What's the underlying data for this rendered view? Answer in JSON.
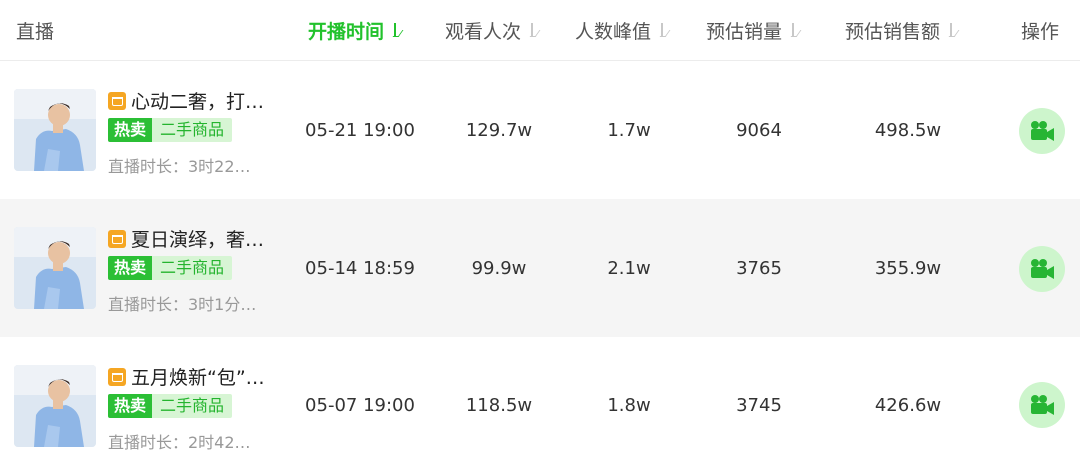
{
  "header": {
    "live": "直播",
    "start_time": "开播时间",
    "views": "观看人次",
    "peak": "人数峰值",
    "est_sales": "预估销量",
    "est_gmv": "预估销售额",
    "actions": "操作"
  },
  "colors": {
    "accent": "#22c22c",
    "tag_hot_bg": "#2bbf35",
    "tag_used_bg": "#d7f5d4",
    "cart_icon": "#f5a623",
    "action_bg": "#cdf5cc",
    "striped_row": "#f5f5f5"
  },
  "rows": [
    {
      "title": "心动二奢，打…",
      "tag_hot": "热卖",
      "tag_category": "二手商品",
      "duration": "直播时长：3时22…",
      "start_time": "05-21 19:00",
      "views": "129.7w",
      "peak": "1.7w",
      "est_sales": "9064",
      "est_gmv": "498.5w",
      "action_icon": "video-camera-icon"
    },
    {
      "title": "夏日演绎，奢…",
      "tag_hot": "热卖",
      "tag_category": "二手商品",
      "duration": "直播时长：3时1分…",
      "start_time": "05-14 18:59",
      "views": "99.9w",
      "peak": "2.1w",
      "est_sales": "3765",
      "est_gmv": "355.9w",
      "action_icon": "video-camera-icon"
    },
    {
      "title": "五月焕新“包”…",
      "tag_hot": "热卖",
      "tag_category": "二手商品",
      "duration": "直播时长：2时42…",
      "start_time": "05-07 19:00",
      "views": "118.5w",
      "peak": "1.8w",
      "est_sales": "3745",
      "est_gmv": "426.6w",
      "action_icon": "video-camera-icon"
    }
  ]
}
